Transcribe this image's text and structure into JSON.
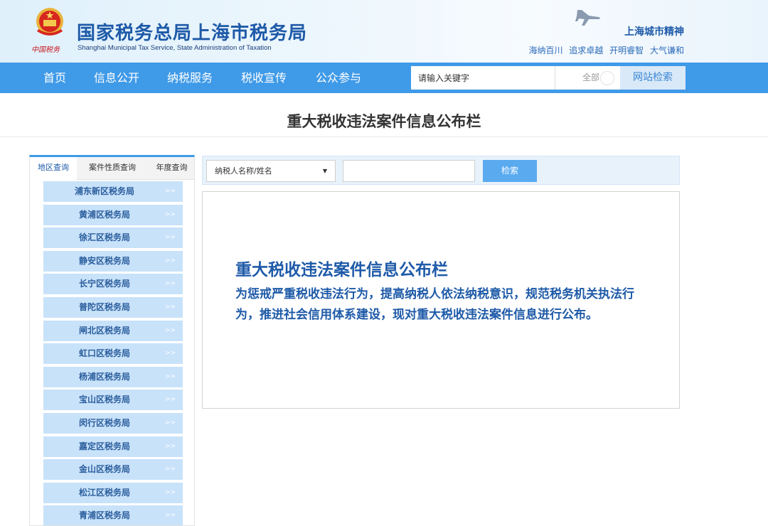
{
  "header": {
    "emblem_caption": "中国税务",
    "title_cn": "国家税务总局上海市税务局",
    "title_en": "Shanghai Municipal Tax Service, State Administration of Taxation",
    "spirit_title": "上海城市精神",
    "spirit_words": [
      "海纳百川",
      "追求卓越",
      "开明睿智",
      "大气谦和"
    ],
    "colors": {
      "brand": "#1e5aa8",
      "emblem_red": "#c8161d"
    },
    "icons": [
      "national-emblem-icon",
      "airplane-icon"
    ]
  },
  "nav": {
    "items": [
      "首页",
      "信息公开",
      "纳税服务",
      "税收宣传",
      "公众参与"
    ],
    "search_placeholder": "请输入关键字",
    "scope_label": "全部",
    "search_button": "网站检索",
    "colors": {
      "bar": "#3f9ae8"
    }
  },
  "page": {
    "title": "重大税收违法案件信息公布栏"
  },
  "left": {
    "tabs": [
      "地区查询",
      "案件性质查询",
      "年度查询"
    ],
    "active_tab": "地区查询",
    "offices": [
      "浦东新区税务局",
      "黄浦区税务局",
      "徐汇区税务局",
      "静安区税务局",
      "长宁区税务局",
      "普陀区税务局",
      "闸北区税务局",
      "虹口区税务局",
      "杨浦区税务局",
      "宝山区税务局",
      "闵行区税务局",
      "嘉定区税务局",
      "金山区税务局",
      "松江区税务局",
      "青浦区税务局"
    ],
    "arrow": ">>",
    "colors": {
      "item_bg": "#c8e2fa",
      "item_text": "#2a5d9c"
    }
  },
  "search": {
    "field_label": "纳税人名称/姓名",
    "keyword_value": "",
    "button": "检索"
  },
  "info": {
    "title": "重大税收违法案件信息公布栏",
    "text": "为惩戒严重税收违法行为，提高纳税人依法纳税意识，规范税务机关执法行为，推进社会信用体系建设，现对重大税收违法案件信息进行公布。"
  }
}
